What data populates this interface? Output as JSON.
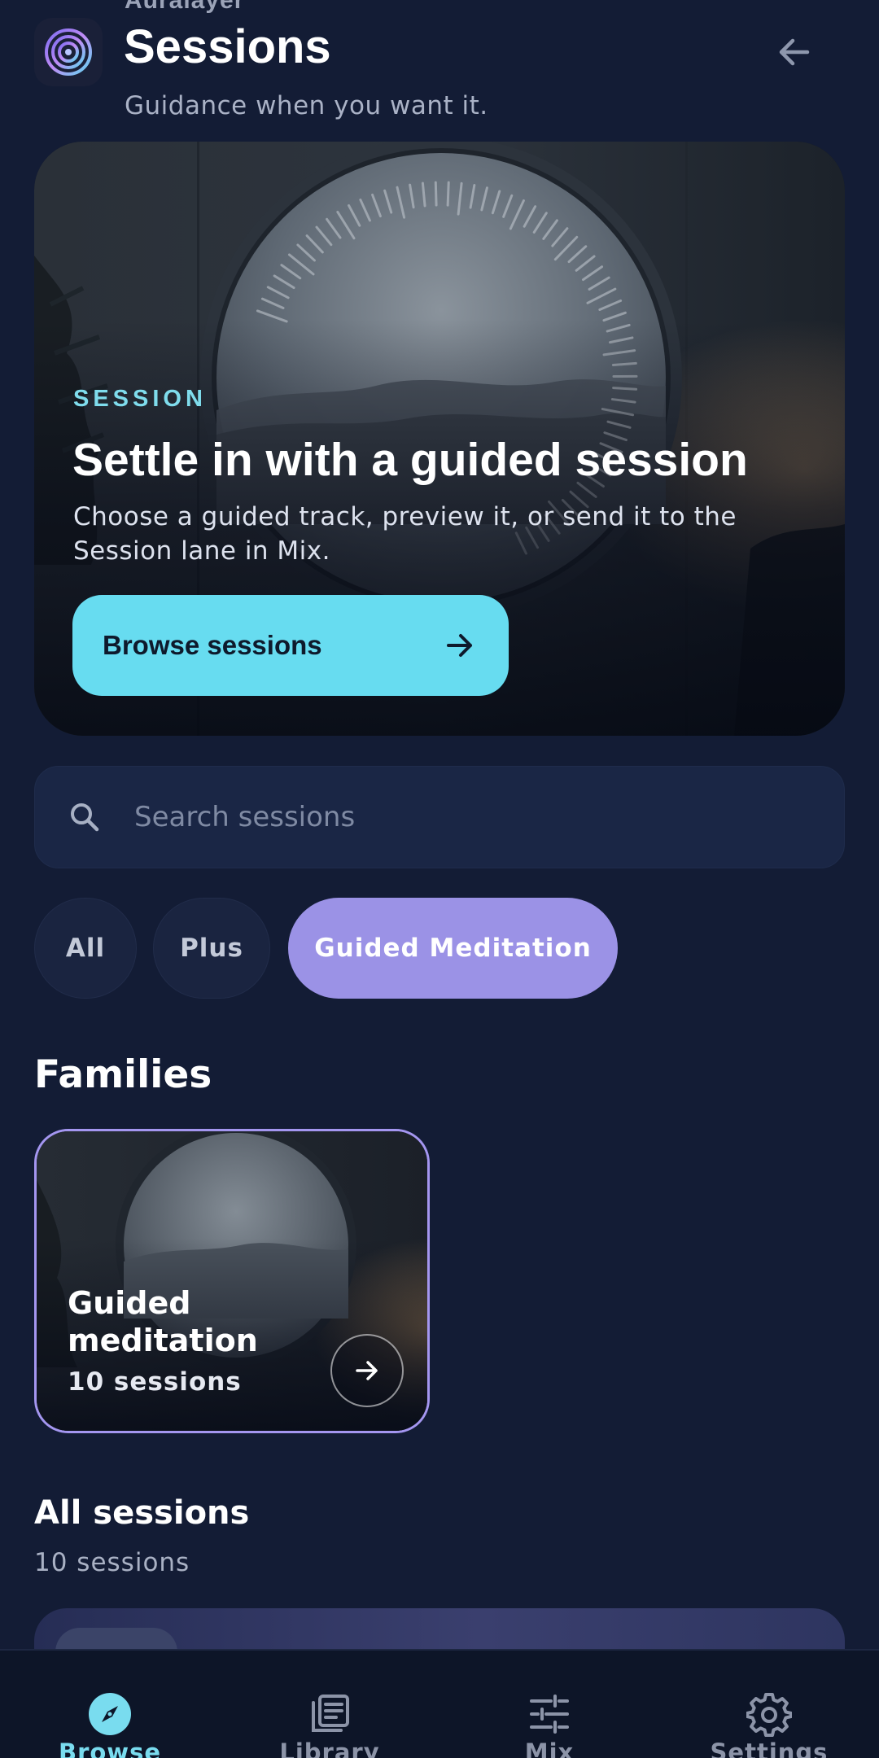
{
  "header": {
    "app_name": "Auralayer",
    "title": "Sessions",
    "subtitle": "Guidance when you want it."
  },
  "hero": {
    "eyebrow": "SESSION",
    "title": "Settle in with a guided session",
    "body": "Choose a guided track, preview it, or send it to the Session lane in Mix.",
    "cta_label": "Browse sessions"
  },
  "search": {
    "placeholder": "Search sessions",
    "value": ""
  },
  "filters": {
    "chips": [
      "All",
      "Plus",
      "Guided Meditation"
    ],
    "selected": "Guided Meditation"
  },
  "families": {
    "heading": "Families",
    "cards": [
      {
        "title": "Guided meditation",
        "count": "10 sessions"
      }
    ]
  },
  "all_sessions": {
    "heading": "All sessions",
    "count": "10 sessions"
  },
  "bottom_nav": {
    "items": [
      {
        "label": "Browse",
        "icon": "compass-icon",
        "active": true
      },
      {
        "label": "Library",
        "icon": "library-icon",
        "active": false
      },
      {
        "label": "Mix",
        "icon": "sliders-icon",
        "active": false
      },
      {
        "label": "Settings",
        "icon": "gear-icon",
        "active": false
      }
    ]
  },
  "colors": {
    "background": "#131c35",
    "accent_cyan": "#67dcf0",
    "accent_violet": "#9b92e6",
    "eyebrow": "#7fdcec"
  }
}
